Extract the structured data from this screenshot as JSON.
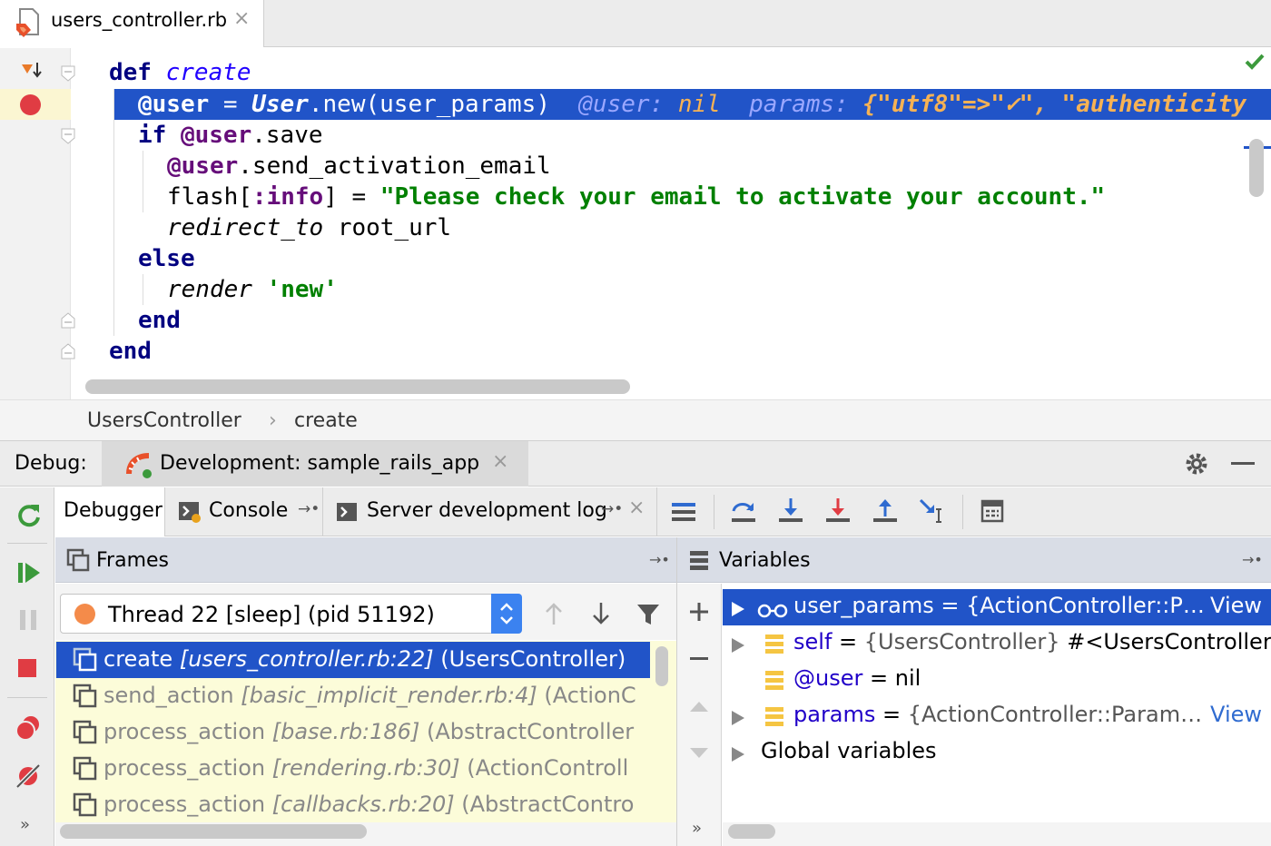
{
  "editor": {
    "tab_name": "users_controller.rb",
    "tab_close": "×",
    "lines": {
      "l1_kw": "def",
      "l1_fn": "create",
      "l2_var": "@user",
      "l2_eq": " = ",
      "l2_cls": "User",
      "l2_rest": ".new(user_params)",
      "l2_inline1": "@user:",
      "l2_inline1v": "nil",
      "l2_inline2": "params:",
      "l2_inline2v": "{\"utf8\"=>\"✓\", \"authenticity",
      "l3_kw": "if",
      "l3_var": "@user",
      "l3_rest": ".save",
      "l4_var": "@user",
      "l4_rest": ".send_activation_email",
      "l5_pre": "flash[",
      "l5_sym": ":info",
      "l5_mid": "] = ",
      "l5_str": "\"Please check your email to activate your account.\"",
      "l6_it": "redirect_to",
      "l6_rest": " root_url",
      "l7_kw": "else",
      "l8_it": "render",
      "l8_str": "'new'",
      "l9_kw": "end",
      "l10_kw": "end"
    }
  },
  "breadcrumb": {
    "item1": "UsersController",
    "sep": "›",
    "item2": "create"
  },
  "debug": {
    "label": "Debug:",
    "run_config": "Development: sample_rails_app",
    "close": "×"
  },
  "tabs": {
    "debugger": "Debugger",
    "console": "Console",
    "server_log": "Server development log"
  },
  "frames": {
    "title": "Frames",
    "thread": "Thread 22 [sleep] (pid 51192)",
    "items": [
      {
        "name": "create",
        "loc": "[users_controller.rb:22]",
        "cls": "(UsersController)"
      },
      {
        "name": "send_action",
        "loc": "[basic_implicit_render.rb:4]",
        "cls": "(ActionC"
      },
      {
        "name": "process_action",
        "loc": "[base.rb:186]",
        "cls": "(AbstractController"
      },
      {
        "name": "process_action",
        "loc": "[rendering.rb:30]",
        "cls": "(ActionControll"
      },
      {
        "name": "process_action",
        "loc": "[callbacks.rb:20]",
        "cls": "(AbstractContro"
      }
    ]
  },
  "variables": {
    "title": "Variables",
    "items": [
      {
        "name": "user_params",
        "eq": " = ",
        "val": "{ActionController::P…",
        "link": "View"
      },
      {
        "name": "self",
        "eq": " = ",
        "val": "{UsersController}",
        "val2": " #<UsersController"
      },
      {
        "name": "@user",
        "eq": " = ",
        "val": "nil"
      },
      {
        "name": "params",
        "eq": " = ",
        "val": "{ActionController::Param…",
        "link": "View"
      },
      {
        "name": "Global variables"
      }
    ]
  },
  "colors": {
    "selection": "#2154c8",
    "frames_bg": "#fcfcd9",
    "accent_green": "#3c9a3c"
  }
}
